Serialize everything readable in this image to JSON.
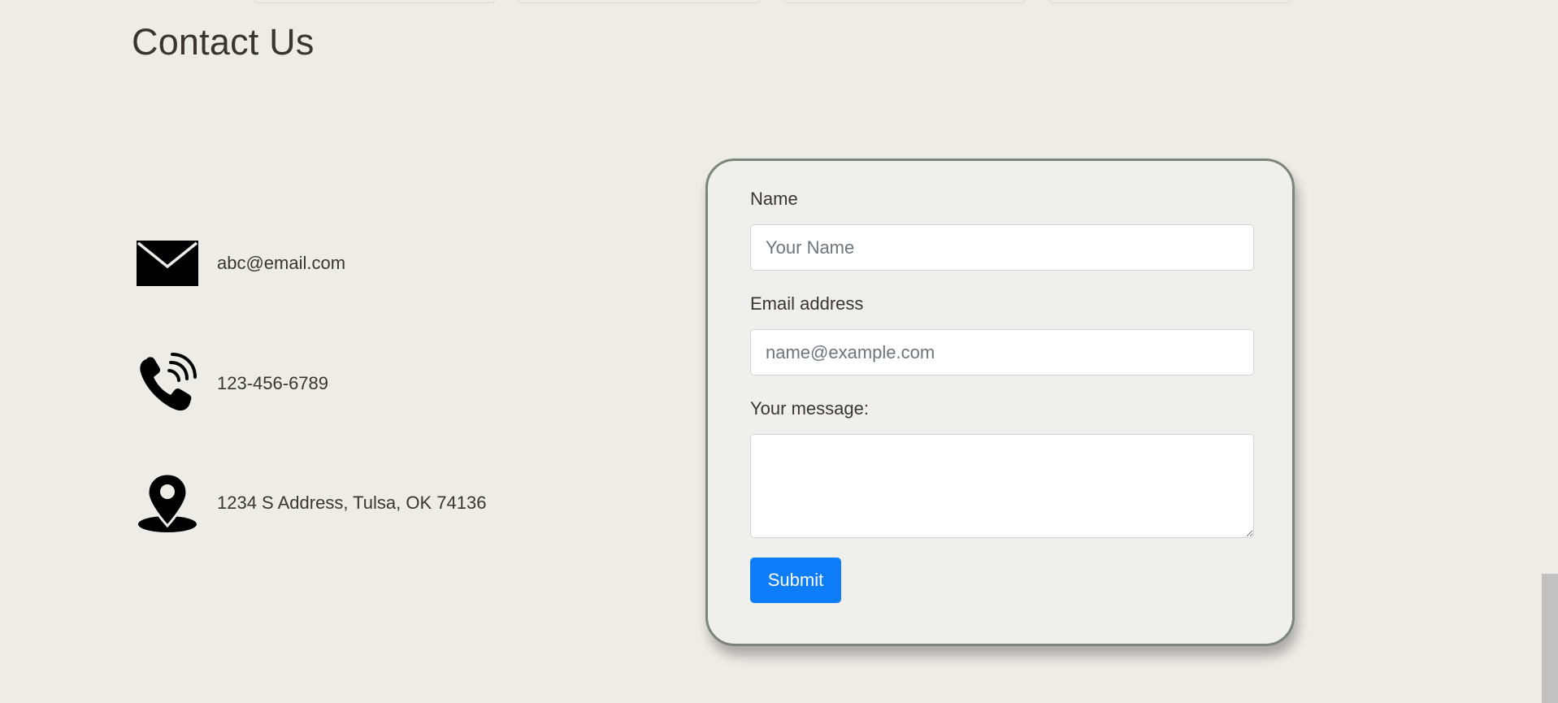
{
  "page": {
    "title": "Contact Us"
  },
  "contact": {
    "items": [
      {
        "icon": "envelope-icon",
        "text": "abc@email.com"
      },
      {
        "icon": "phone-icon",
        "text": "123-456-6789"
      },
      {
        "icon": "location-pin-icon",
        "text": "1234 S Address, Tulsa, OK 74136"
      }
    ]
  },
  "form": {
    "name_label": "Name",
    "name_placeholder": "Your Name",
    "name_value": "",
    "email_label": "Email address",
    "email_placeholder": "name@example.com",
    "email_value": "",
    "message_label": "Your message:",
    "message_value": "",
    "submit_label": "Submit"
  },
  "colors": {
    "background": "#eeece7",
    "card_background": "#eff0ed",
    "card_border": "#7c857c",
    "submit": "#0d7df9",
    "text": "#3a3530"
  }
}
